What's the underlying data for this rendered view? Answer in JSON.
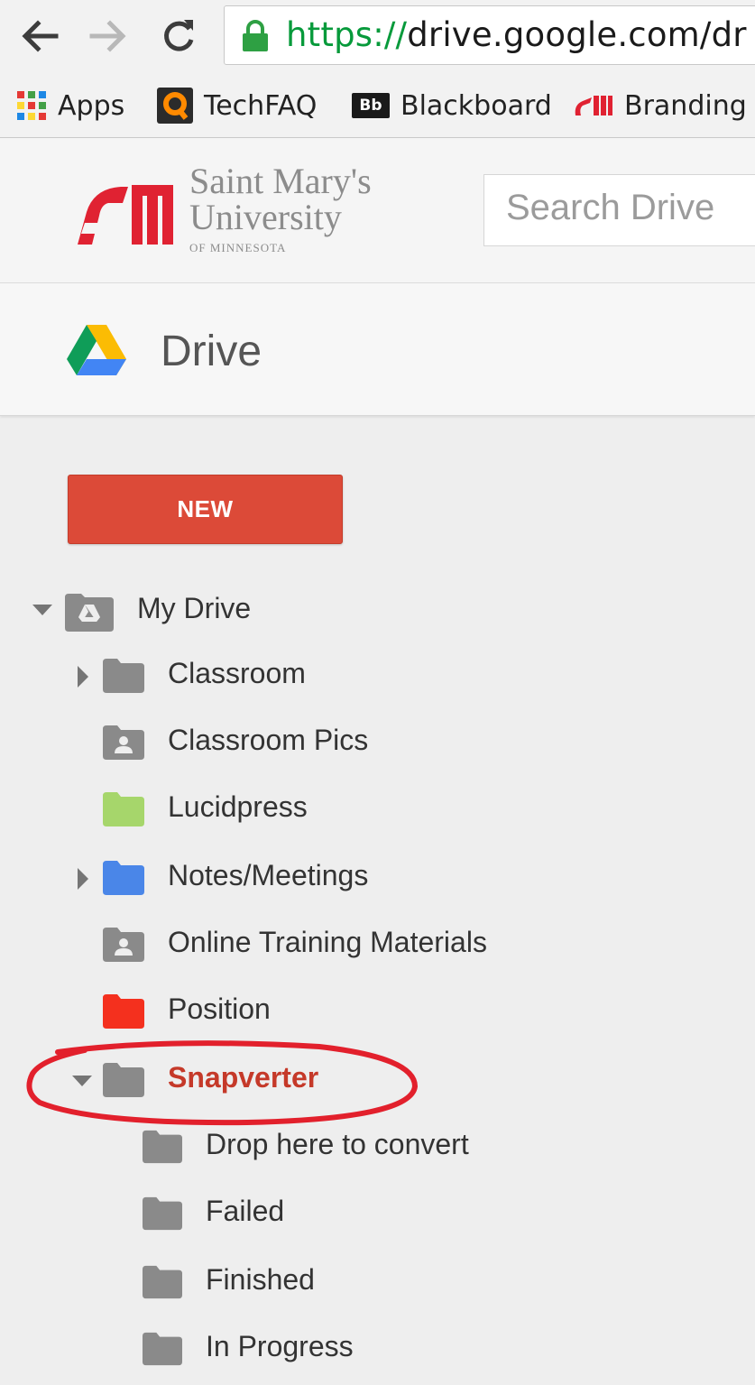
{
  "browser": {
    "url_scheme": "https://",
    "url_rest": "drive.google.com/dr",
    "bookmarks": [
      {
        "label": "Apps",
        "icon": "apps-grid-icon"
      },
      {
        "label": "TechFAQ",
        "icon": "techfaq-icon"
      },
      {
        "label": "Blackboard",
        "icon": "blackboard-icon"
      },
      {
        "label": "Branding",
        "icon": "smu-logo-icon"
      }
    ],
    "blackboard_icon_text": "Bb"
  },
  "university": {
    "logo_line1": "Saint Mary's",
    "logo_line2": "University",
    "logo_line3": "OF MINNESOTA",
    "search_placeholder": "Search Drive"
  },
  "drive": {
    "title": "Drive",
    "new_label": "NEW"
  },
  "tree": {
    "my_drive": "My Drive",
    "items": [
      {
        "label": "Classroom",
        "color": "#8a8a8a",
        "type": "folder",
        "expandable": true
      },
      {
        "label": "Classroom Pics",
        "color": "#8a8a8a",
        "type": "shared-folder",
        "expandable": false
      },
      {
        "label": "Lucidpress",
        "color": "#a6d66b",
        "type": "folder",
        "expandable": false
      },
      {
        "label": "Notes/Meetings",
        "color": "#4a86e8",
        "type": "folder",
        "expandable": true
      },
      {
        "label": "Online Training Materials",
        "color": "#8a8a8a",
        "type": "shared-folder",
        "expandable": false
      },
      {
        "label": "Position",
        "color": "#f4301e",
        "type": "folder",
        "expandable": false
      },
      {
        "label": "Snapverter",
        "color": "#8a8a8a",
        "type": "folder",
        "expanded": true,
        "active": true
      }
    ],
    "snapverter_children": [
      {
        "label": "Drop here to convert"
      },
      {
        "label": "Failed"
      },
      {
        "label": "Finished"
      },
      {
        "label": "In Progress"
      }
    ]
  },
  "colors": {
    "new_button": "#dc4a38",
    "active_text": "#c53929",
    "annotation_ellipse": "#e2202c"
  }
}
